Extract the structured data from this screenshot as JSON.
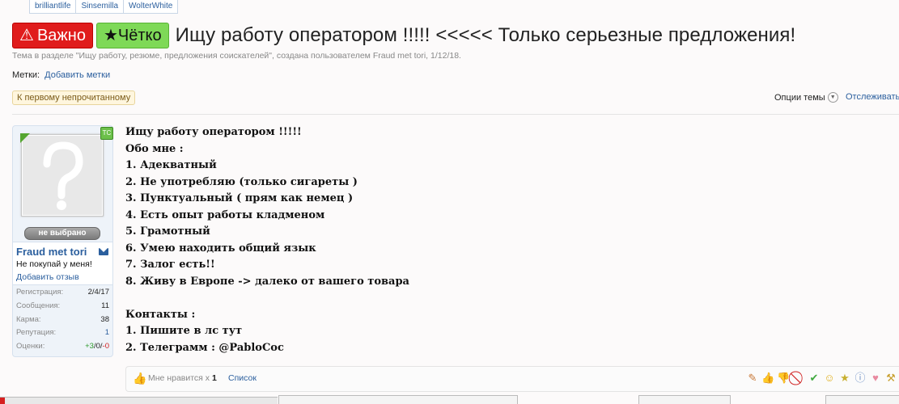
{
  "top_tabs": [
    "brilliantlife",
    "Sinsemilla",
    "WolterWhite"
  ],
  "header": {
    "important_label": "Важно",
    "neat_label": "Чётко",
    "title": "Ищу работу оператором !!!!! <<<<< Только серьезные предложения!",
    "meta": "Тема в разделе \"Ищу работу, резюме, предложения соискателей\", создана пользователем Fraud met tori, 1/12/18.",
    "tags_label": "Метки:",
    "add_tags": "Добавить метки"
  },
  "toolbar": {
    "first_unread": "К первому непрочитанному",
    "thread_options": "Опции темы",
    "watch": "Отслеживать"
  },
  "user": {
    "ts_badge": "ТС",
    "not_chosen": "не выбрано",
    "name": "Fraud met tori",
    "status": "Не покупай у меня!",
    "add_review": "Добавить отзыв",
    "stats": [
      {
        "key": "Регистрация:",
        "value": "2/4/17"
      },
      {
        "key": "Сообщения:",
        "value": "11"
      },
      {
        "key": "Карма:",
        "value": "38"
      },
      {
        "key": "Репутация:",
        "value": "1"
      }
    ],
    "ratings_label": "Оценки:",
    "ratings": {
      "plus": "+3",
      "zero": "0",
      "minus": "-0"
    }
  },
  "post": {
    "lines": [
      "Ищу работу оператором !!!!!",
      "Обо мне :",
      "1. Адекватный",
      "2. Не употребляю (только сигареты )",
      "3. Пунктуальный ( прям как немец )",
      "4. Есть опыт работы кладменом",
      "5. Грамотный",
      "6. Умею находить общий язык",
      "7. Залог есть!!",
      "8. Живу в Европе -> далеко от вашего товара",
      "",
      "Контакты :",
      "1. Пишите в лс тут",
      "2. Телеграмм : @PabloCoc"
    ]
  },
  "likes": {
    "text": "Мне нравится х",
    "count": "1",
    "list_link": "Список"
  },
  "rate_icons": [
    "badge-icon",
    "thumbs-up-icon",
    "thumbs-down-icon",
    "ban-icon",
    "check-icon",
    "smile-icon",
    "star-icon",
    "info-icon",
    "heart-icon",
    "wrench-icon"
  ]
}
